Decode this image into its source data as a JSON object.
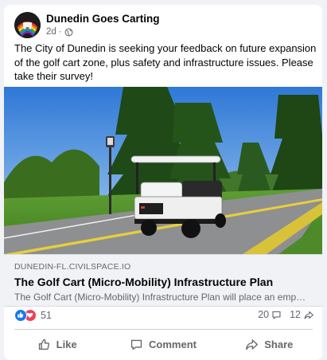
{
  "post": {
    "page_name": "Dunedin Goes Carting",
    "time": "2d",
    "privacy_icon": "globe-icon",
    "text": "The City of Dunedin is seeking your feedback on future expansion of the golf cart zone, plus safety and infrastructure issues. Please take their survey!"
  },
  "link": {
    "domain": "DUNEDIN-FL.CIVILSPACE.IO",
    "title": "The Golf Cart (Micro-Mobility) Infrastructure Plan",
    "description": "The Golf Cart (Micro-Mobility) Infrastructure Plan will place an emp…"
  },
  "stats": {
    "reaction_icons": [
      "like-icon",
      "love-icon"
    ],
    "reactions_count": "51",
    "comments_count": "20",
    "shares_count": "12"
  },
  "actions": {
    "like": "Like",
    "comment": "Comment",
    "share": "Share"
  },
  "colors": {
    "like_blue": "#1877f2",
    "love_red": "#f33e58",
    "secondary_text": "#65676b"
  }
}
